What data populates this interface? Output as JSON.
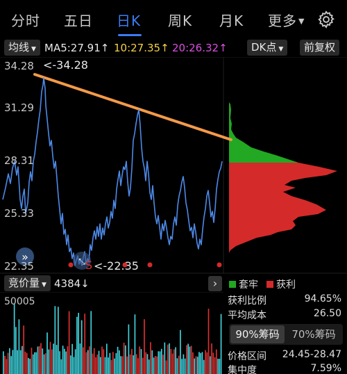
{
  "tabs": [
    "分时",
    "五日",
    "日K",
    "周K",
    "月K",
    "更多"
  ],
  "active_tab": "日K",
  "indicator_select": "均线",
  "ma5": "MA5:27.91↑",
  "ma10": "10:27.35↑",
  "ma20": "20:26.32↑",
  "dk_button": "DK点",
  "adjust_button": "前复权",
  "price_axis": [
    "34.28",
    "31.29",
    "28.31",
    "25.33",
    "22.35"
  ],
  "max_label": "<-34.28",
  "min_label": "<-22.35",
  "signal_letter": "S",
  "volume": {
    "select": "竞价量",
    "value": "4384↓",
    "axis_top": "50005"
  },
  "chip_panel": {
    "legend_trapped": "套牢",
    "legend_profit": "获利",
    "profit_ratio_label": "获利比例",
    "profit_ratio": "94.65%",
    "avg_cost_label": "平均成本",
    "avg_cost": "26.50",
    "toggle_90": "90%筹码",
    "toggle_70": "70%筹码",
    "price_range_label": "价格区间",
    "price_range": "24.45-28.47",
    "concentration_label": "集中度",
    "concentration": "7.59%"
  },
  "colors": {
    "accent": "#3d7bf2",
    "price_line": "#4d8ae8",
    "trend_line": "#f39a4a",
    "chip_profit": "#d42a2a",
    "chip_trapped": "#22a822",
    "ma5": "#e8e8e8",
    "ma10": "#f5d14a",
    "ma20": "#d94fe0",
    "vol_up": "#e03030",
    "vol_down": "#3fd6e0"
  }
}
